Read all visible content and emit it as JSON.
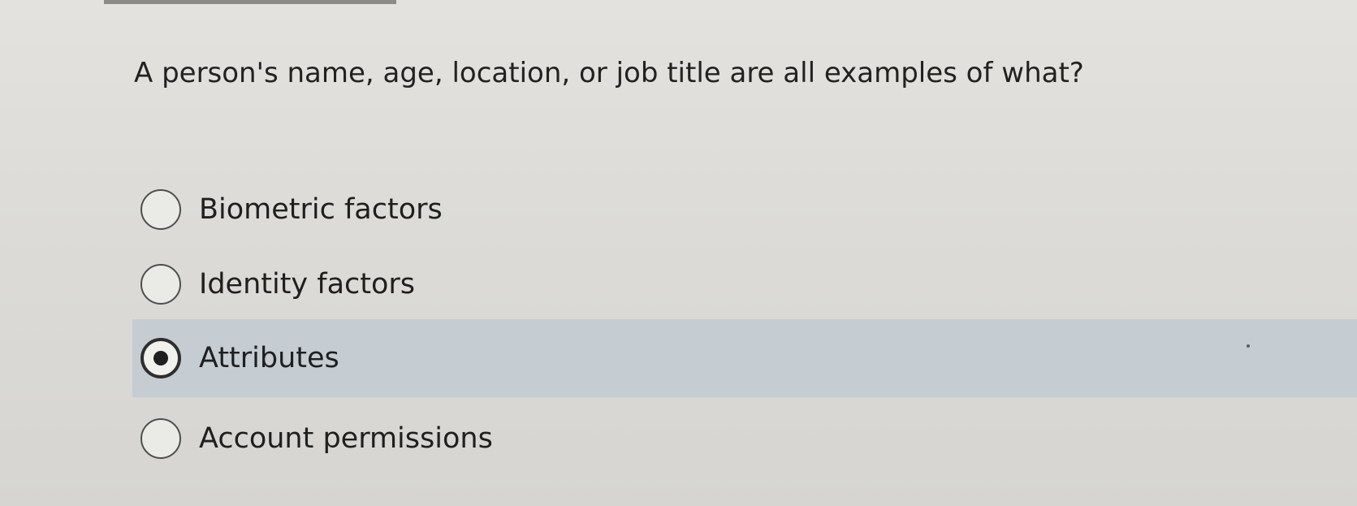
{
  "question": {
    "text": "A person's name, age, location, or job title are all examples of what?"
  },
  "options": [
    {
      "label": "Biometric factors",
      "selected": false
    },
    {
      "label": "Identity factors",
      "selected": false
    },
    {
      "label": "Attributes",
      "selected": true
    },
    {
      "label": "Account permissions",
      "selected": false
    }
  ],
  "colors": {
    "background": "#dcdbd7",
    "selected_highlight": "#c5cdd2",
    "text": "#1f1f1f",
    "radio_border": "#4e4e4e"
  },
  "icons": {
    "radio_unselected": "radio-empty-icon",
    "radio_selected": "radio-selected-icon"
  }
}
